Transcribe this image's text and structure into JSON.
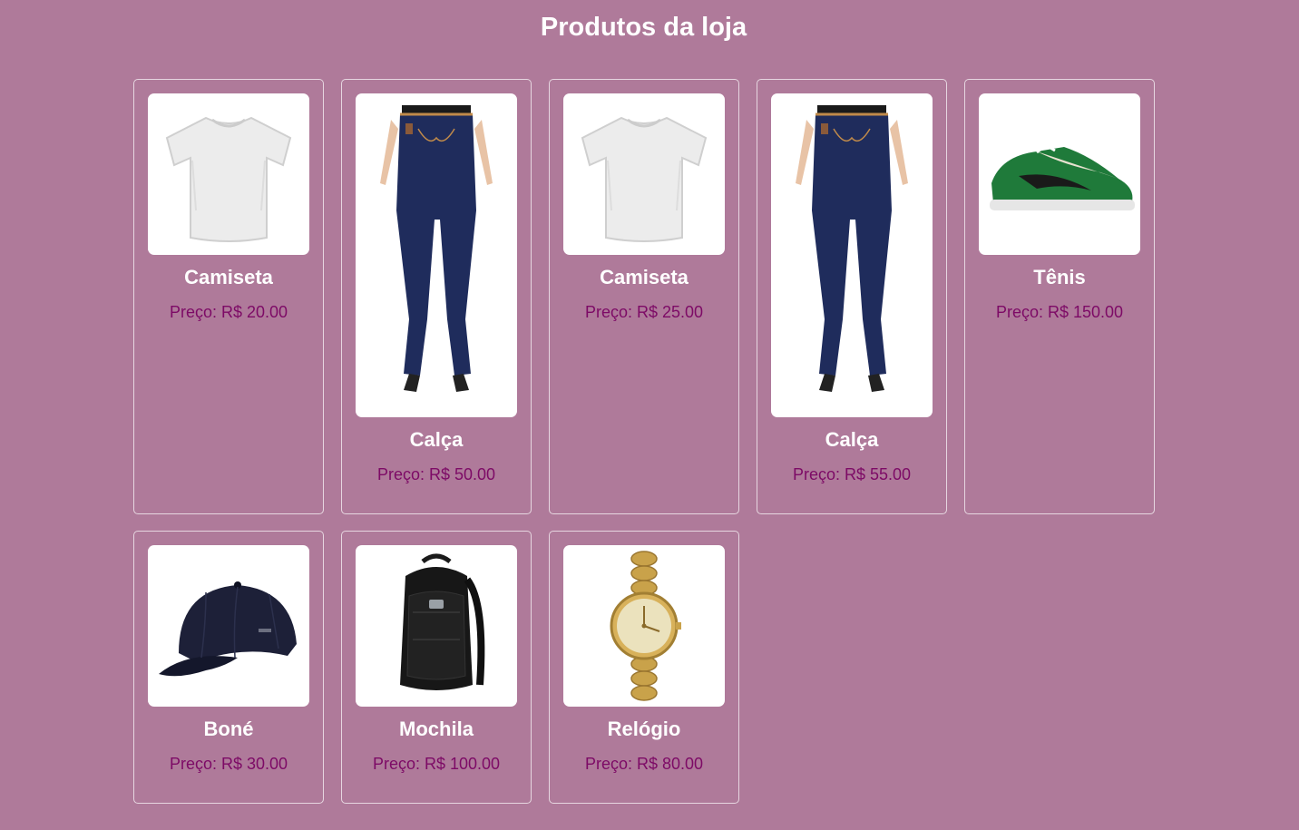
{
  "page": {
    "title": "Produtos da loja",
    "background_color": "#af7a9a",
    "price_color": "#7d0a66"
  },
  "products": [
    {
      "name": "Camiseta",
      "price": "Preço: R$ 20.00",
      "image": "white-tshirt"
    },
    {
      "name": "Calça",
      "price": "Preço: R$ 50.00",
      "image": "blue-jeans"
    },
    {
      "name": "Camiseta",
      "price": "Preço: R$ 25.00",
      "image": "white-tshirt"
    },
    {
      "name": "Calça",
      "price": "Preço: R$ 55.00",
      "image": "blue-jeans"
    },
    {
      "name": "Tênis",
      "price": "Preço: R$ 150.00",
      "image": "green-sneaker"
    },
    {
      "name": "Boné",
      "price": "Preço: R$ 30.00",
      "image": "navy-cap"
    },
    {
      "name": "Mochila",
      "price": "Preço: R$ 100.00",
      "image": "black-backpack"
    },
    {
      "name": "Relógio",
      "price": "Preço: R$ 80.00",
      "image": "gold-watch"
    }
  ]
}
